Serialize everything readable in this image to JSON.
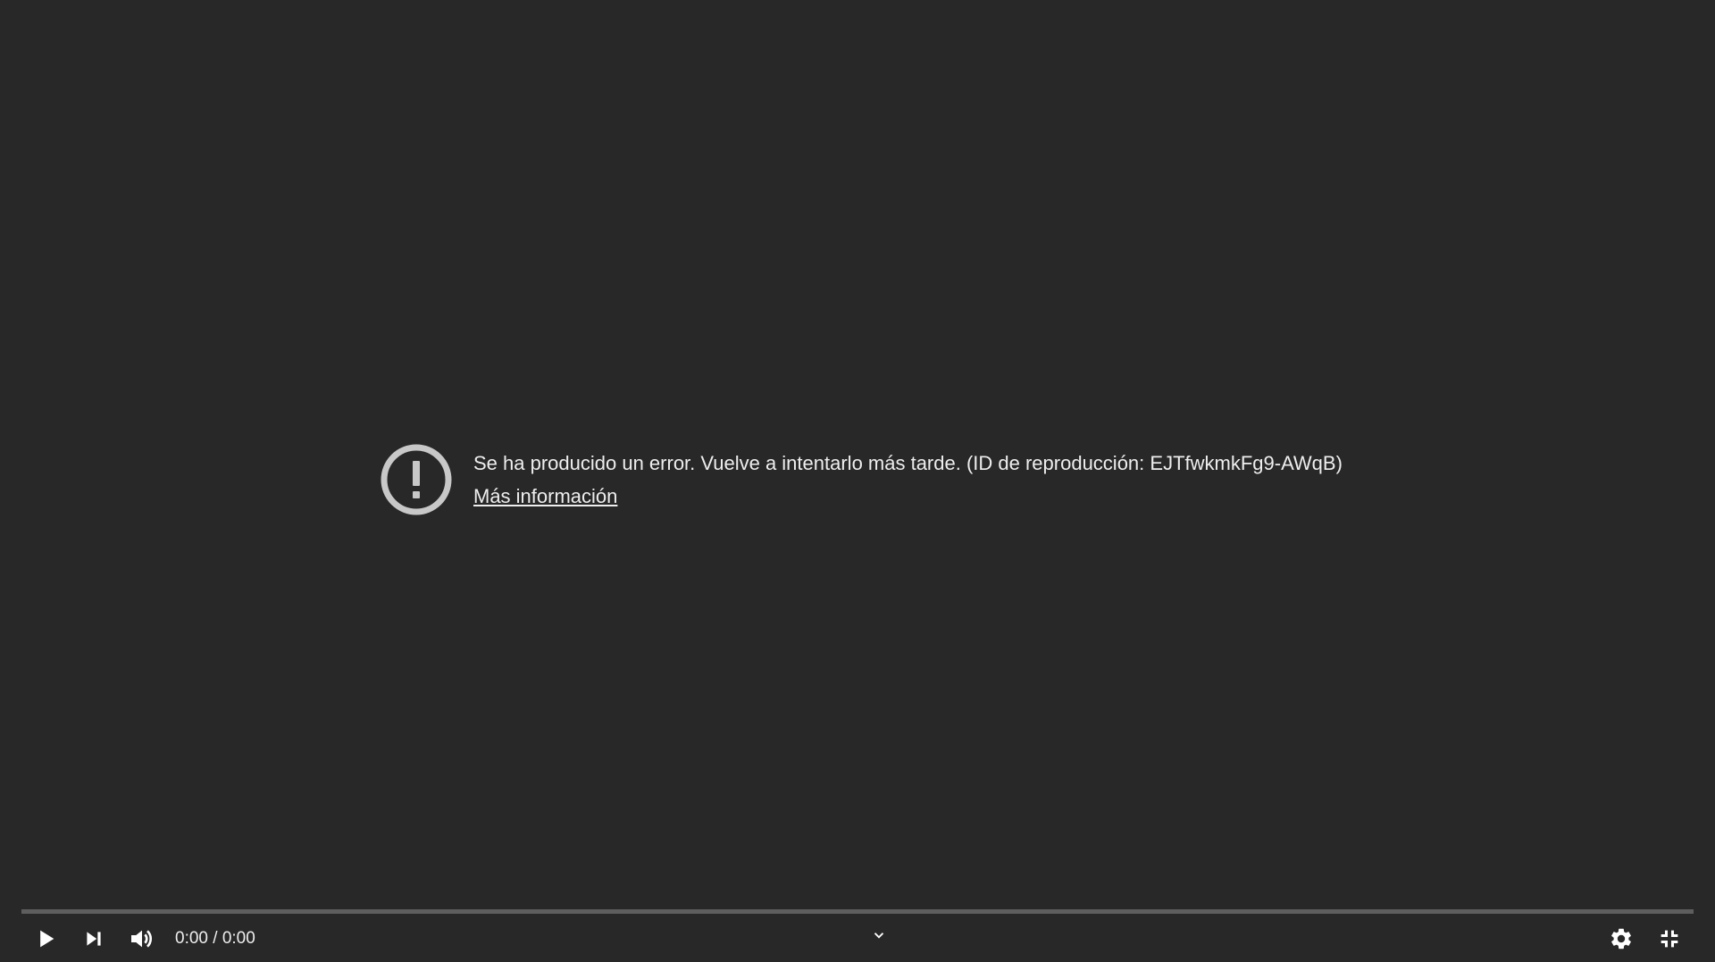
{
  "error": {
    "message": "Se ha producido un error. Vuelve a intentarlo más tarde. (ID de reproducción: EJTfwkmkFg9-AWqB)",
    "link_label": "Más información",
    "icon": "alert-circle-icon"
  },
  "progress": {
    "fraction": 0
  },
  "controls": {
    "time_current": "0:00",
    "time_separator": "/",
    "time_duration": "0:00",
    "icons": [
      "play-icon",
      "next-icon",
      "volume-icon",
      "chevron-down-icon",
      "gear-icon",
      "exit-fullscreen-icon"
    ]
  },
  "colors": {
    "background": "#282828",
    "text": "#eeeeee",
    "icon_error": "#c8c8c8",
    "progress_track": "#5a5a5a"
  }
}
